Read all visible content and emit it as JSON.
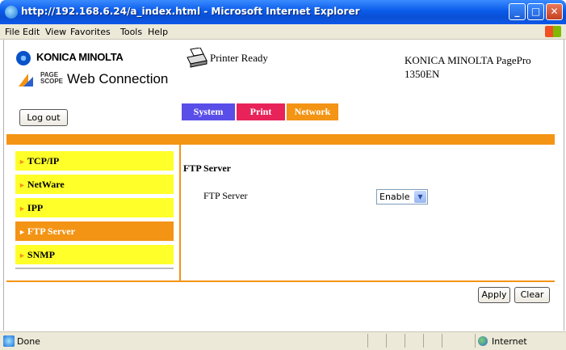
{
  "window": {
    "title": "http://192.168.6.24/a_index.html - Microsoft Internet Explorer",
    "controls": {
      "minimize": "_",
      "maximize": "□",
      "close": "✕"
    }
  },
  "menubar": {
    "items": [
      "File",
      "Edit",
      "View",
      "Favorites",
      "Tools",
      "Help"
    ]
  },
  "header": {
    "brand": "KONICA MINOLTA",
    "pagescope_small": "PAGE SCOPE",
    "pagescope_small_top": "PAGE",
    "pagescope_small_bottom": "SCOPE",
    "product": "Web Connection",
    "printer_status": "Printer Ready",
    "model_line1": "KONICA MINOLTA PagePro",
    "model_line2": "1350EN",
    "logout": "Log out"
  },
  "tabs": [
    {
      "label": "System",
      "color": "#5a4ee8"
    },
    {
      "label": "Print",
      "color": "#e8235a"
    },
    {
      "label": "Network",
      "color": "#f39414",
      "selected": true
    }
  ],
  "sidebar": {
    "items": [
      {
        "label": "TCP/IP",
        "active": false
      },
      {
        "label": "NetWare",
        "active": false
      },
      {
        "label": "IPP",
        "active": false
      },
      {
        "label": "FTP Server",
        "active": true
      },
      {
        "label": "SNMP",
        "active": false
      }
    ],
    "arrow": "►"
  },
  "main": {
    "section_title": "FTP Server",
    "field_label": "FTP Server",
    "field_value": "Enable"
  },
  "actions": {
    "apply": "Apply",
    "clear": "Clear"
  },
  "statusbar": {
    "status": "Done",
    "zone": "Internet"
  },
  "colors": {
    "accent_orange": "#f39414",
    "sidebar_yellow": "#ffff2a"
  }
}
